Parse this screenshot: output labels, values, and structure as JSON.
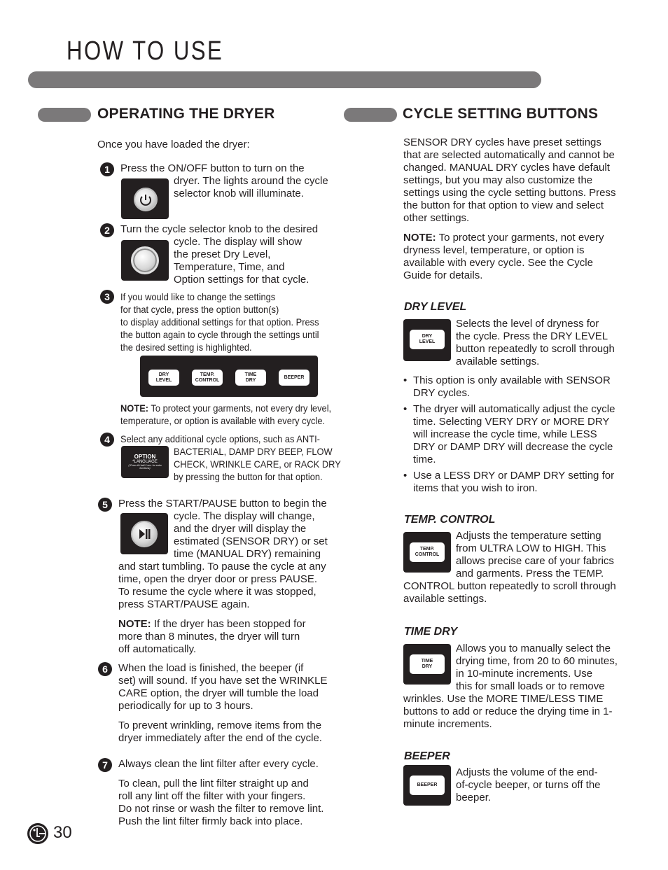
{
  "header": {
    "title": "HOW TO USE"
  },
  "left": {
    "title": "OPERATING THE DRYER",
    "intro": "Once you have loaded the dryer:",
    "steps": [
      {
        "num": "1",
        "lines": [
          "Press the ON/OFF button to turn on the",
          "dryer. The lights around the cycle",
          "selector knob will illuminate."
        ]
      },
      {
        "num": "2",
        "lines": [
          "Turn the cycle selector knob to the desired",
          "cycle. The display will show",
          "the preset Dry Level,",
          "Temperature, Time, and",
          "Option settings for that cycle."
        ]
      },
      {
        "num": "3",
        "lines": [
          "If you would like to change the settings",
          "for that cycle, press the option button(s)",
          "to display additional settings for that option. Press",
          "the button again to cycle through the settings until",
          "the desired setting is highlighted."
        ],
        "panel_keys": [
          "DRY\nLEVEL",
          "TEMP.\nCONTROL",
          "TIME\nDRY",
          "BEEPER"
        ],
        "note_label": "NOTE:",
        "note_lines": [
          " To protect your garments, not every dry level,",
          "temperature, or option is available with every cycle."
        ]
      },
      {
        "num": "4",
        "lines": [
          "Select any additional cycle options, such as ANTI-",
          "BACTERIAL, DAMP DRY BEEP, FLOW",
          "CHECK, WRINKLE CARE, or RACK DRY",
          "by pressing the button for that option."
        ],
        "option_button": {
          "label": "OPTION",
          "sub": "*LANGUAGE",
          "hint": "(*Press & Hold 3 sec. for extra functions)"
        }
      },
      {
        "num": "5",
        "lines": [
          "Press the START/PAUSE button to begin the",
          "cycle. The display will change,",
          "and the dryer will display the",
          "estimated (SENSOR DRY) or set",
          "time (MANUAL DRY) remaining",
          "and start tumbling. To pause the cycle at any",
          "time, open the dryer door or press PAUSE.",
          "To resume the cycle where it was stopped,",
          "press START/PAUSE again."
        ],
        "note_label": "NOTE:",
        "note_lines": [
          " If the dryer has been stopped for",
          "more than 8 minutes, the dryer will turn",
          "off automatically."
        ]
      },
      {
        "num": "6",
        "lines": [
          "When the load is finished, the beeper (if",
          "set) will sound. If you have set the WRINKLE",
          "CARE option, the dryer will tumble the load",
          "periodically for up to 3 hours."
        ],
        "extra_lines": [
          "To prevent wrinkling, remove items from the",
          "dryer immediately after the end of the cycle."
        ]
      },
      {
        "num": "7",
        "lines": [
          "Always clean the lint filter after every cycle."
        ],
        "extra_lines": [
          "To clean, pull the lint filter straight up and",
          "roll any lint off the filter with your fingers.",
          "Do not rinse or wash the filter to remove lint.",
          "Push the lint filter firmly back into place."
        ]
      }
    ]
  },
  "right": {
    "title": "CYCLE SETTING BUTTONS",
    "intro_lines": [
      "SENSOR DRY cycles have preset settings",
      "that are selected automatically and cannot be",
      "changed. MANUAL DRY cycles have default",
      "settings, but you may also customize the",
      "settings using the cycle setting buttons. Press",
      "the button for that option to view and select",
      "other settings."
    ],
    "note_label": "NOTE:",
    "note_lines": [
      " To protect your garments, not every",
      "dryness level, temperature, or option is",
      "available with every cycle. See the Cycle",
      "Guide for details."
    ],
    "sections": [
      {
        "heading": "DRY LEVEL",
        "key": "DRY\nLEVEL",
        "lines": [
          "Selects the level of dryness for",
          "the cycle. Press the DRY LEVEL",
          "button repeatedly to scroll through",
          "available settings."
        ],
        "bullets": [
          [
            "This option is only available with SENSOR",
            "DRY cycles."
          ],
          [
            "The dryer will automatically adjust the cycle",
            "time. Selecting VERY DRY or MORE DRY",
            "will increase the cycle time, while LESS",
            "DRY or DAMP DRY will decrease the cycle",
            "time."
          ],
          [
            "Use a LESS DRY or DAMP DRY setting for",
            "items that you wish to iron."
          ]
        ]
      },
      {
        "heading": "TEMP. CONTROL",
        "key": "TEMP.\nCONTROL",
        "lines": [
          "Adjusts the temperature setting",
          "from ULTRA LOW to HIGH. This",
          "allows precise care of your fabrics",
          "and garments. Press the TEMP.",
          "CONTROL button repeatedly to scroll through",
          "available settings."
        ]
      },
      {
        "heading": "TIME DRY",
        "key": "TIME\nDRY",
        "lines": [
          "Allows you to manually select the",
          "drying time, from 20 to 60 minutes,",
          "in 10-minute increments. Use",
          "this for small loads or to remove",
          "wrinkles. Use the MORE TIME/LESS TIME",
          "buttons to add or reduce the drying time in 1-",
          "minute increments."
        ]
      },
      {
        "heading": "BEEPER",
        "key": "BEEPER",
        "lines": [
          "Adjusts the volume of the end-",
          "of-cycle beeper, or turns off the",
          "beeper."
        ]
      }
    ]
  },
  "footer": {
    "logo": "LG",
    "page_number": "30"
  }
}
